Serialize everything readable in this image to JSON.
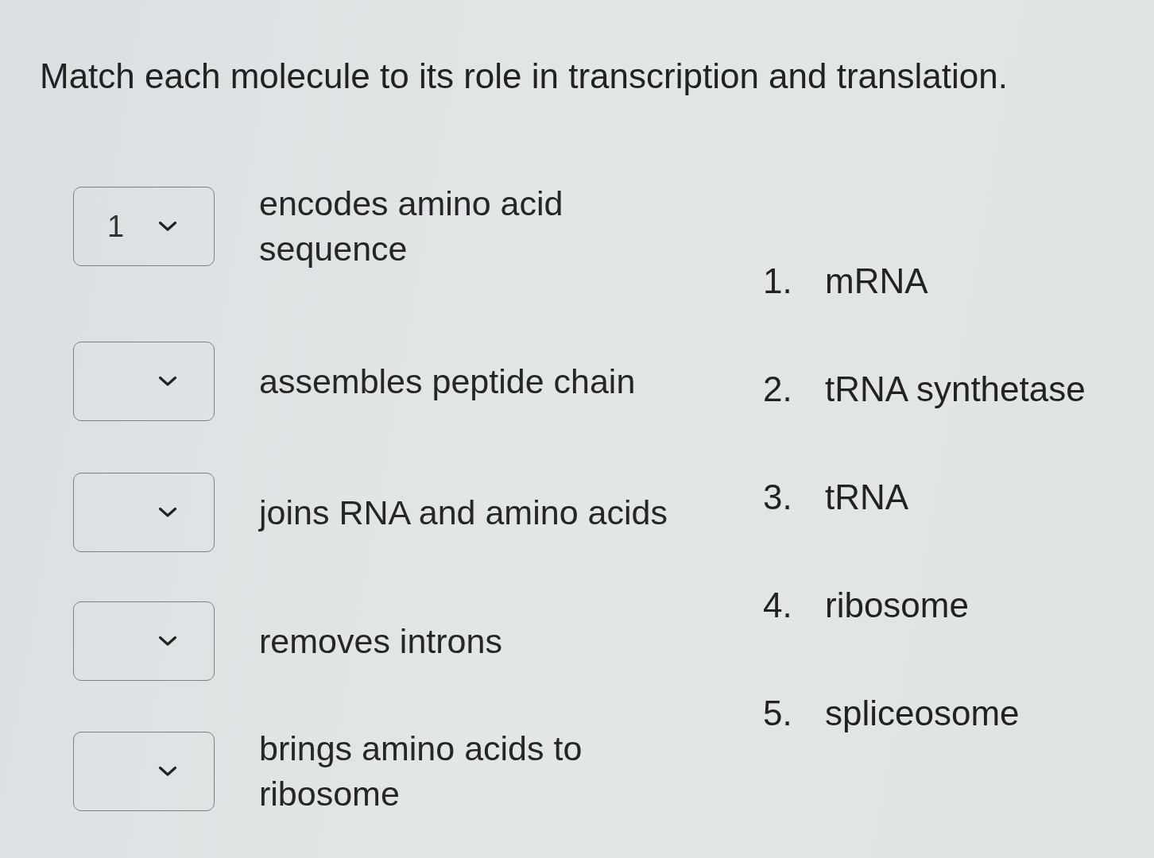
{
  "question": {
    "title": "Match each molecule to its role in transcription and translation."
  },
  "matches": [
    {
      "value": "1",
      "prompt": "encodes amino acid sequence"
    },
    {
      "prompt": "assembles peptide chain"
    },
    {
      "prompt": "joins RNA and amino acids"
    },
    {
      "prompt": "removes introns"
    },
    {
      "prompt": "brings amino acids to ribosome"
    }
  ],
  "options": [
    {
      "number": "1.",
      "label": "mRNA"
    },
    {
      "number": "2.",
      "label": "tRNA synthetase"
    },
    {
      "number": "3.",
      "label": "tRNA"
    },
    {
      "number": "4.",
      "label": "ribosome"
    },
    {
      "number": "5.",
      "label": "spliceosome"
    }
  ]
}
